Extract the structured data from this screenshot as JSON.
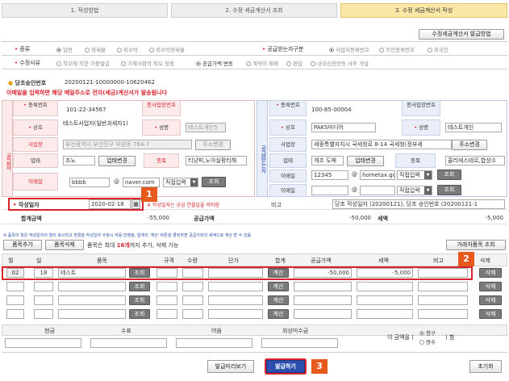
{
  "steps": [
    "1. 작성방법",
    "2. 수정 세금계산서 조회",
    "3. 수정 세금계산서 작성"
  ],
  "top_button": "수정세금계산서 발급방법",
  "type_label": "종류",
  "type_options": [
    "일반",
    "영세율",
    "위수탁",
    "위수탁영세율"
  ],
  "receiver_label": "공급받는자구분",
  "receiver_options": [
    "사업자등록번호",
    "주민등록번호",
    "외국인"
  ],
  "reason_label": "수정사유",
  "reason_options": [
    "착오에 의한 이중발급",
    "기재사항의 착오 정정",
    "공급가액 변동",
    "계약의 해제",
    "환입",
    "내국신용장등 사후 개설"
  ],
  "approval_label": "당초승인번호",
  "approval_value": "20200121-10000000-10620462",
  "notice": "이메일을 입력하면 해당 메일주소로 전자(세금)계산서가 발송됩니다",
  "supplier": {
    "side_label": "공급자",
    "reg_label": "등록번호",
    "reg_value": "101-22-34567",
    "sub_label": "종사업장번호",
    "name_label": "상호",
    "name_value": "테스트사업자(일반과세자1)",
    "ceo_label": "성명",
    "ceo_value": "테스트개인5",
    "addr_label": "사업장",
    "addr_value": "부산광역시 부산진구 부암동 764-7",
    "addr_btn": "주소변경",
    "biz_label": "업태",
    "biz_value": "조노",
    "biz_btn": "업태변경",
    "item_label": "종목",
    "item_value": "티냥피,노아실팡티해",
    "email_label": "이메일",
    "email_id": "bbbb",
    "email_domain": "naver.com",
    "email_select": "직접입력",
    "lookup": "조회"
  },
  "buyer": {
    "side_label": "공급받는자",
    "reg_label": "등록번호",
    "reg_value": "100-85-00004",
    "sub_label": "종사업장번호",
    "name_label": "상호",
    "name_value": "PAKS미디어",
    "ceo_label": "성명",
    "ceo_value": "테스트개인",
    "addr_label": "사업장",
    "addr_value": "세종특별자치시 국세청로 8-14 국세청(정부세",
    "addr_btn": "주소변경",
    "biz_label": "업태",
    "biz_value": "개조 도매",
    "biz_btn": "업태변경",
    "item_label": "종목",
    "item_value": "콜리에스테르,합성수",
    "email1_label": "이메일",
    "email1_id": "12345",
    "email1_domain": "hometax.go",
    "email_select": "직접입력",
    "email2_label": "이메일",
    "lookup": "조회"
  },
  "date_label": "작성일자",
  "date_value": "2020-02-18",
  "date_warn": "※ 작성일자는 공급 연월일을 의미함",
  "remark_label": "비고",
  "remark_value": "당초 작성일자 (20200121), 당초 승인번호 (20200121-1",
  "totals": {
    "sum_label": "합계금액",
    "sum_value": "-55,000",
    "supply_label": "공급가액",
    "supply_value": "-50,000",
    "tax_label": "세액",
    "tax_value": "-5,000"
  },
  "items_note": "※ 품목의 월은 작성일자의 월이 표시되고 변경을 작성일자 수정시 자동 반영됨, 합계의 '계산' 버튼을 클릭하면 공급가와의 세액으로 계산 할 수 있음",
  "items_toolbar": {
    "add": "품목추가",
    "delete": "품목삭제",
    "hint_pre": "품목은 최대 ",
    "hint_count": "16개",
    "hint_post": "까지 추가, 삭제 가능",
    "lookup": "거래처품목 조회"
  },
  "item_headers": [
    "월",
    "일",
    "품목",
    "규격",
    "수량",
    "단가",
    "합계",
    "공급가액",
    "세액",
    "비고",
    "삭제"
  ],
  "item_rows": [
    {
      "month": "02",
      "day": "18",
      "name": "테스트",
      "lookup": "조회",
      "calc": "계산",
      "supply": "-50,000",
      "tax": "-5,000",
      "del": "삭제"
    },
    {
      "month": "",
      "day": "",
      "name": "",
      "lookup": "조회",
      "calc": "계산",
      "supply": "",
      "tax": "",
      "del": "삭제"
    },
    {
      "month": "",
      "day": "",
      "name": "",
      "lookup": "조회",
      "calc": "계산",
      "supply": "",
      "tax": "",
      "del": "삭제"
    },
    {
      "month": "",
      "day": "",
      "name": "",
      "lookup": "조회",
      "calc": "계산",
      "supply": "",
      "tax": "",
      "del": "삭제"
    }
  ],
  "pay_headers": [
    "현금",
    "수표",
    "어음",
    "외상미수금"
  ],
  "amount_text_pre": "이 금액을 (",
  "amount_opt1": "청구",
  "amount_opt2": "영수",
  "amount_text_post": ") 함",
  "buttons": {
    "preview": "발급미리보기",
    "issue": "발급하기",
    "reset": "초기화"
  },
  "badges": [
    "1",
    "2",
    "3"
  ],
  "colors": {
    "required": "#d9232d",
    "badge": "#e65a1e",
    "issue_button": "#2b4fae",
    "active_step": "#fbe7a6"
  }
}
